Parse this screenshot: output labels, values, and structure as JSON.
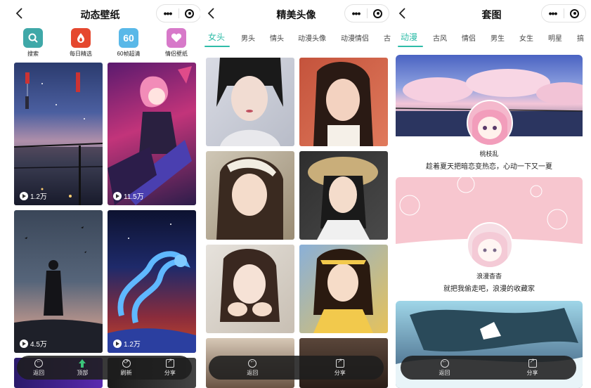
{
  "panel1": {
    "title": "动态壁纸",
    "quick": [
      {
        "label": "搜索",
        "icon": "search-icon",
        "color": "#3fa8a8"
      },
      {
        "label": "每日精选",
        "icon": "drop-icon",
        "color": "#e5482f"
      },
      {
        "label": "60帧超清",
        "icon": "60fps-icon",
        "color": "#59b8e8",
        "glyph": "60"
      },
      {
        "label": "情侣壁纸",
        "icon": "heart-icon",
        "color": "#d779c9"
      }
    ],
    "cards": [
      {
        "count": "1.2万"
      },
      {
        "count": "11.5万"
      },
      {
        "count": "4.5万"
      },
      {
        "count": "1.2万"
      }
    ],
    "bar": [
      {
        "label": "返回",
        "icon": "back-icon"
      },
      {
        "label": "顶部",
        "icon": "top-icon"
      },
      {
        "label": "刷新",
        "icon": "refresh-icon"
      },
      {
        "label": "分享",
        "icon": "share-icon"
      }
    ]
  },
  "panel2": {
    "title": "精美头像",
    "tabs": [
      "女头",
      "男头",
      "情头",
      "动漫头像",
      "动漫情侣",
      "古"
    ],
    "active_tab": 0,
    "bar": [
      {
        "label": "返回",
        "icon": "back-icon"
      },
      {
        "label": "分享",
        "icon": "share-icon"
      }
    ]
  },
  "panel3": {
    "title": "套图",
    "tabs": [
      "动漫",
      "古风",
      "情侣",
      "男生",
      "女生",
      "明星",
      "搞"
    ],
    "active_tab": 0,
    "sets": [
      {
        "name": "桃枝乱",
        "desc": "趁着夏天把暗恋变热恋，心动一下又一夏"
      },
      {
        "name": "浪漫杳杳",
        "desc": "就把我偷走吧，浪漫的收藏家"
      }
    ],
    "bar": [
      {
        "label": "返回",
        "icon": "back-icon"
      },
      {
        "label": "分享",
        "icon": "share-icon"
      }
    ]
  },
  "colors": {
    "accent": "#2fbca8",
    "bar_bg": "#1e1e1e"
  }
}
